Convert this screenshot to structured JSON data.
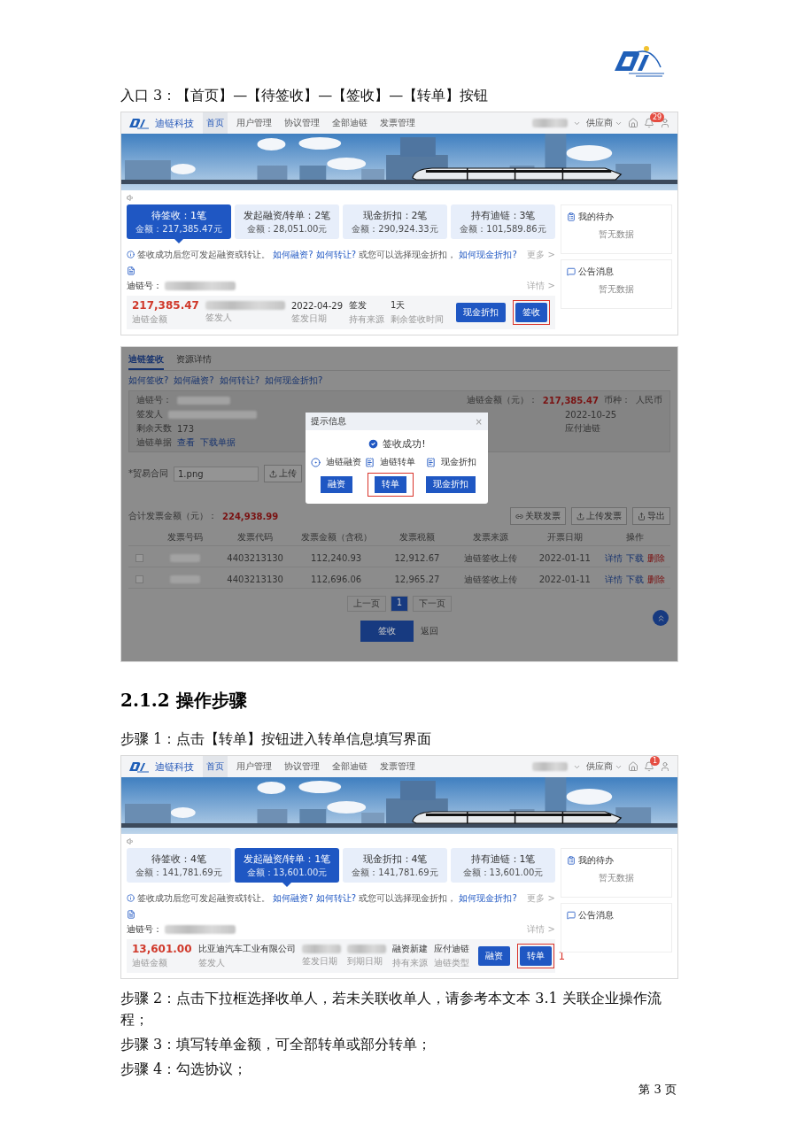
{
  "blocks": [
    {
      "kind": "caption",
      "text": "入口 3：【首页】—【待签收】—【签收】—【转单】按钮"
    },
    {
      "kind": "home_screen",
      "nav": {
        "brand": "迪链科技",
        "menu": [
          {
            "label": "首页",
            "selected": true
          },
          {
            "label": "用户管理",
            "selected": false
          },
          {
            "label": "协议管理",
            "selected": false
          },
          {
            "label": "全部迪链",
            "selected": false
          },
          {
            "label": "发票管理",
            "selected": false
          }
        ],
        "role": "供应商",
        "badge": "29"
      },
      "tabs": [
        {
          "title": "待签收：1笔",
          "amount": "金额：217,385.47元",
          "selected": true
        },
        {
          "title": "发起融资/转单：2笔",
          "amount": "金额：28,051.00元",
          "selected": false
        },
        {
          "title": "现金折扣：2笔",
          "amount": "金额：290,924.33元",
          "selected": false
        },
        {
          "title": "持有迪链：3笔",
          "amount": "金额：101,589.86元",
          "selected": false
        }
      ],
      "notice": [
        {
          "text": "签收成功后您可发起融资或转让。",
          "link": false
        },
        {
          "text": "如何融资?",
          "link": true
        },
        {
          "text": "如何转让?",
          "link": true
        },
        {
          "text": "或您可以选择现金折扣，",
          "link": false
        },
        {
          "text": "如何现金折扣?",
          "link": true
        }
      ],
      "more": "更多 >",
      "chain_label": "迪链号：",
      "details": "详情 >",
      "record": {
        "amount": "217,385.47",
        "amount_label": "迪链金额",
        "fields": [
          {
            "label": "签发人",
            "blurred": true
          },
          {
            "value": "2022-04-29",
            "label": "签发日期",
            "blurred": false
          },
          {
            "value": "签发",
            "label": "持有来源",
            "blurred": false
          },
          {
            "value": "1天",
            "label": "剩余签收时间",
            "blurred": false
          }
        ],
        "buttons": [
          {
            "label": "现金折扣",
            "highlighted": false
          },
          {
            "label": "签收",
            "highlighted": true
          }
        ]
      },
      "sidebar": [
        {
          "kind": "todo",
          "title": "我的待办",
          "empty_text": "暂无数据"
        },
        {
          "kind": "news",
          "title": "公告消息",
          "empty_text": "暂无数据"
        }
      ]
    },
    {
      "kind": "dialog_screen",
      "tabs": [
        {
          "label": "迪链签收",
          "selected": true
        },
        {
          "label": "资源详情",
          "selected": false
        }
      ],
      "help_links": [
        "如何签收?",
        "如何融资?",
        "如何转让?",
        "如何现金折扣?"
      ],
      "info": {
        "chain_label": "迪链号：",
        "amount_label": "迪链金额（元）：",
        "amount": "217,385.47",
        "currency_label": "币种：",
        "currency": "人民币",
        "rows": [
          {
            "kind": "blurred",
            "label": "签发人",
            "right": "2022-10-25"
          },
          {
            "kind": "value",
            "label": "剩余天数",
            "value": "173",
            "right": "应付迪链"
          },
          {
            "kind": "links",
            "label": "迪链单据",
            "links": [
              "查看",
              "下载单据"
            ]
          }
        ]
      },
      "contract": {
        "label": "*贸易合同",
        "file": "1.png",
        "upload": "上传"
      },
      "invoice_total": {
        "label": "合计发票金额（元）：",
        "amount": "224,938.99"
      },
      "toolbar": [
        {
          "kind": "link",
          "label": "关联发票"
        },
        {
          "kind": "upload",
          "label": "上传发票"
        },
        {
          "kind": "export",
          "label": "导出"
        }
      ],
      "table": {
        "columns": [
          "发票号码",
          "发票代码",
          "发票金额（含税）",
          "发票税额",
          "发票来源",
          "开票日期",
          "操作"
        ],
        "rows": [
          {
            "checked": false,
            "cells": [
              null,
              "4403213130",
              "112,240.93",
              "12,912.67",
              "迪链签收上传",
              "2022-01-11"
            ],
            "actions": [
              {
                "label": "详情",
                "danger": false
              },
              {
                "label": "下载",
                "danger": false
              },
              {
                "label": "删除",
                "danger": true
              }
            ]
          },
          {
            "checked": false,
            "cells": [
              null,
              "4403213130",
              "112,696.06",
              "12,965.27",
              "迪链签收上传",
              "2022-01-11"
            ],
            "actions": [
              {
                "label": "详情",
                "danger": false
              },
              {
                "label": "下载",
                "danger": false
              },
              {
                "label": "删除",
                "danger": true
              }
            ]
          }
        ]
      },
      "pagination": {
        "prev": "上一页",
        "pages": [
          {
            "label": "1",
            "selected": true
          }
        ],
        "next": "下一页"
      },
      "submit": "签收",
      "back": "返回",
      "dialog": {
        "title": "提示信息",
        "close": "×",
        "message": "签收成功!",
        "options": [
          {
            "kind": "finance",
            "label": "迪链融资",
            "button": "融资",
            "highlighted": false
          },
          {
            "kind": "transfer",
            "label": "迪链转单",
            "button": "转单",
            "highlighted": true
          },
          {
            "kind": "discount",
            "label": "现金折扣",
            "button": "现金折扣",
            "highlighted": false
          }
        ]
      }
    },
    {
      "kind": "heading",
      "text": "2.1.2 操作步骤"
    },
    {
      "kind": "caption",
      "text": "步骤 1：点击【转单】按钮进入转单信息填写界面"
    },
    {
      "kind": "home_screen",
      "nav": {
        "brand": "迪链科技",
        "menu": [
          {
            "label": "首页",
            "selected": true
          },
          {
            "label": "用户管理",
            "selected": false
          },
          {
            "label": "协议管理",
            "selected": false
          },
          {
            "label": "全部迪链",
            "selected": false
          },
          {
            "label": "发票管理",
            "selected": false
          }
        ],
        "role": "供应商",
        "badge": "1"
      },
      "tabs": [
        {
          "title": "待签收：4笔",
          "amount": "金额：141,781.69元",
          "selected": false
        },
        {
          "title": "发起融资/转单：1笔",
          "amount": "金额：13,601.00元",
          "selected": true
        },
        {
          "title": "现金折扣：4笔",
          "amount": "金额：141,781.69元",
          "selected": false
        },
        {
          "title": "持有迪链：1笔",
          "amount": "金额：13,601.00元",
          "selected": false
        }
      ],
      "notice": [
        {
          "text": "签收成功后您可发起融资或转让。",
          "link": false
        },
        {
          "text": "如何融资?",
          "link": true
        },
        {
          "text": "如何转让?",
          "link": true
        },
        {
          "text": "或您可以选择现金折扣，",
          "link": false
        },
        {
          "text": "如何现金折扣?",
          "link": true
        }
      ],
      "more": "更多 >",
      "chain_label": "迪链号：",
      "details": "详情 >",
      "record": {
        "amount": "13,601.00",
        "amount_label": "迪链金额",
        "fields": [
          {
            "value": "比亚迪汽车工业有限公司",
            "label": "签发人",
            "blurred": false
          },
          {
            "label": "签发日期",
            "blurred": true
          },
          {
            "label": "到期日期",
            "blurred": true
          },
          {
            "value": "融资新建",
            "label": "持有来源",
            "blurred": false
          },
          {
            "value": "应付迪链",
            "label": "迪链类型",
            "blurred": false
          }
        ],
        "buttons": [
          {
            "label": "融资",
            "highlighted": false
          },
          {
            "label": "转单",
            "highlighted": true
          }
        ],
        "annotation": "1"
      },
      "sidebar": [
        {
          "kind": "todo",
          "title": "我的待办",
          "empty_text": "暂无数据"
        },
        {
          "kind": "news",
          "title": "公告消息"
        }
      ]
    },
    {
      "kind": "caption",
      "text": "步骤 2：点击下拉框选择收单人，若未关联收单人，请参考本文本 3.1 关联企业操作流程；"
    },
    {
      "kind": "caption",
      "text": "步骤 3：填写转单金额，可全部转单或部分转单；"
    },
    {
      "kind": "caption",
      "text": "步骤 4：勾选协议；"
    }
  ],
  "page_number": "第 3 页"
}
